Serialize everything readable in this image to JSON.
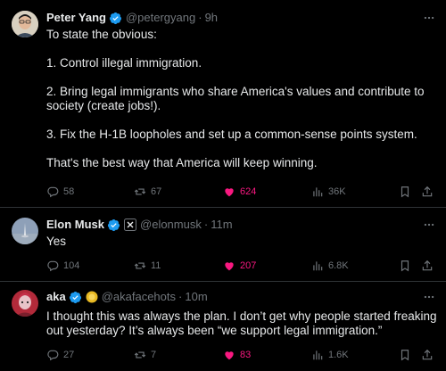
{
  "tweets": [
    {
      "name": "Peter Yang",
      "handle": "@petergyang",
      "time": "9h",
      "text_lines": [
        "To state the obvious:",
        "",
        "1. Control illegal immigration.",
        "",
        "2. Bring legal immigrants who share America's values and contribute to",
        "society (create jobs!).",
        "",
        "3. Fix the H-1B loopholes and set up a common-sense points system.",
        "",
        "That's the best way that America will keep winning."
      ],
      "replies": "58",
      "reposts": "67",
      "likes": "624",
      "views": "36K"
    },
    {
      "name": "Elon Musk",
      "handle": "@elonmusk",
      "time": "11m",
      "text_lines": [
        "Yes"
      ],
      "replies": "104",
      "reposts": "11",
      "likes": "207",
      "views": "6.8K"
    },
    {
      "name": "aka",
      "handle": "@akafacehots",
      "time": "10m",
      "text_lines": [
        "I thought this was always the plan. I don’t get why people started freaking",
        "out yesterday? It’s always been “we support legal immigration.”"
      ],
      "replies": "27",
      "reposts": "7",
      "likes": "83",
      "views": "1.6K"
    }
  ],
  "separator": "·",
  "colors": {
    "background": "#000000",
    "text": "#e7e9ea",
    "muted": "#71767b",
    "like": "#f91880",
    "verified": "#1d9bf0",
    "divider": "#2f3336"
  },
  "icons": [
    "verified-badge-icon",
    "x-affiliate-badge-icon",
    "gold-affiliate-badge-icon",
    "more-icon",
    "reply-icon",
    "repost-icon",
    "like-icon",
    "views-icon",
    "bookmark-icon",
    "share-icon"
  ]
}
